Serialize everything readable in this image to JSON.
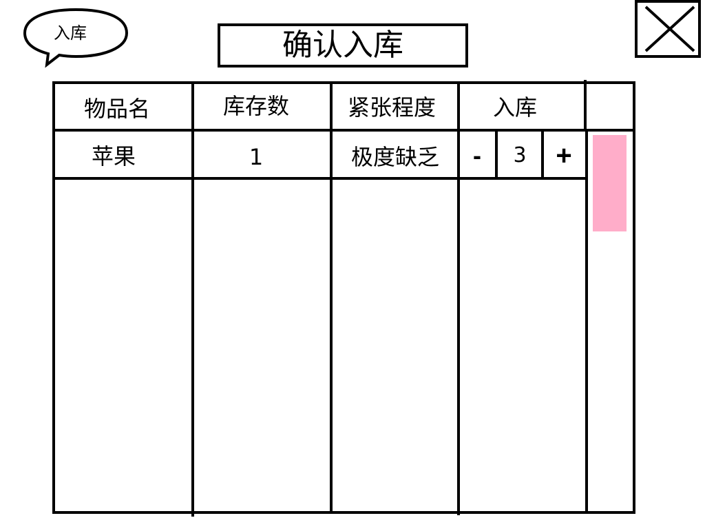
{
  "bubble": {
    "label": "入库"
  },
  "header": {
    "confirm_label": "确认入库"
  },
  "close": {
    "icon": "close-icon"
  },
  "table": {
    "columns": [
      "物品名",
      "库存数",
      "紧张程度",
      "入库"
    ],
    "rows": [
      {
        "name": "苹果",
        "stock": "1",
        "urgency": "极度缺乏",
        "qty": "3",
        "minus": "-",
        "plus": "+"
      }
    ]
  },
  "colors": {
    "border": "#000000",
    "scroll_thumb": "#ffadc9",
    "background": "#ffffff"
  }
}
